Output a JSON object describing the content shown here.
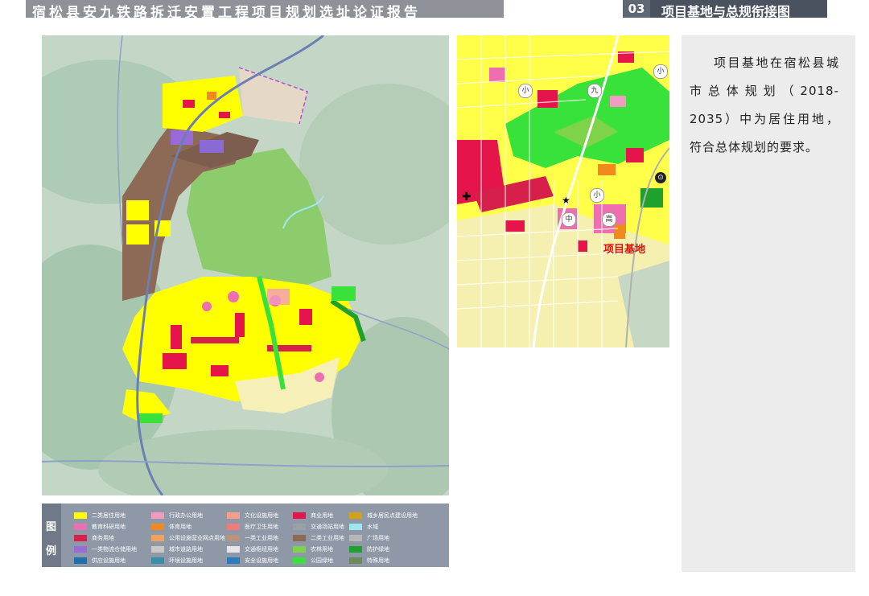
{
  "header": {
    "title": "宿松县安九铁路拆迁安置工程项目规划选址论证报告",
    "section_number": "03",
    "section_title": "项目基地与总规衔接图"
  },
  "description": "项目基地在宿松县城市总体规划（2018-2035）中为居住用地，符合总体规划的要求。",
  "inset_map": {
    "label": "项目基地",
    "circle_labels": [
      "小",
      "九",
      "小",
      "中",
      "高",
      "小"
    ]
  },
  "legend": {
    "title_chars": [
      "图",
      "例"
    ],
    "items": [
      {
        "label": "二类居住用地",
        "color": "#ffff00"
      },
      {
        "label": "行政办公用地",
        "color": "#f39ac0"
      },
      {
        "label": "文化设施用地",
        "color": "#f2a08a"
      },
      {
        "label": "商业用地",
        "color": "#e5144b"
      },
      {
        "label": "城乡居民点建设用地",
        "color": "#d4a017"
      },
      {
        "label": "教育科研用地",
        "color": "#ee6fb0"
      },
      {
        "label": "体育用地",
        "color": "#f08a1c"
      },
      {
        "label": "医疗卫生用地",
        "color": "#ef7b7b"
      },
      {
        "label": "交通场站用地",
        "color": "#9aa0a8"
      },
      {
        "label": "水域",
        "color": "#9fe7ef"
      },
      {
        "label": "商务用地",
        "color": "#d61f4a"
      },
      {
        "label": "公用设施营业网点用地",
        "color": "#f0a25a"
      },
      {
        "label": "一类工业用地",
        "color": "#b9937a"
      },
      {
        "label": "二类工业用地",
        "color": "#8d6a55"
      },
      {
        "label": "广场用地",
        "color": "#b7b7b7"
      },
      {
        "label": "一类物流仓储用地",
        "color": "#9a6bd6"
      },
      {
        "label": "城市道路用地",
        "color": "#c9c9c9"
      },
      {
        "label": "交通枢纽用地",
        "color": "#e6e6e6"
      },
      {
        "label": "农林用地",
        "color": "#7fd34a"
      },
      {
        "label": "防护绿地",
        "color": "#1fa12d"
      },
      {
        "label": "供应设施用地",
        "color": "#1f6fa8"
      },
      {
        "label": "环境设施用地",
        "color": "#3a8fa8"
      },
      {
        "label": "安全设施用地",
        "color": "#2a7dbf"
      },
      {
        "label": "公园绿地",
        "color": "#39e23a"
      },
      {
        "label": "特殊用地",
        "color": "#6a8a5a"
      }
    ]
  }
}
